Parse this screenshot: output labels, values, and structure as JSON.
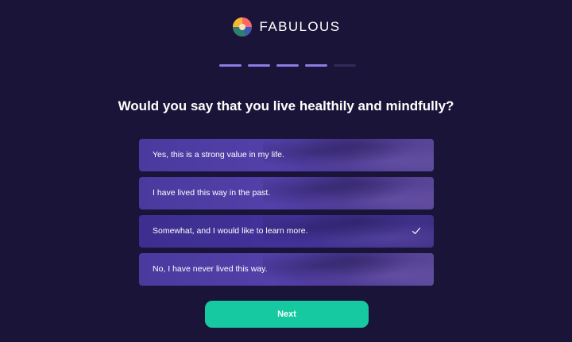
{
  "brand": {
    "name": "FABULOUS",
    "logo_icon": "fabulous-logo-icon"
  },
  "progress": {
    "total_steps": 5,
    "completed_steps": 4,
    "active_color": "#8d7be6",
    "inactive_color": "#312a58"
  },
  "question": {
    "text": "Would you say that you live healthily and mindfully?"
  },
  "options": [
    {
      "label": "Yes, this is a strong value in my life.",
      "selected": false
    },
    {
      "label": "I have lived this way in the past.",
      "selected": false
    },
    {
      "label": "Somewhat, and I would like to learn more.",
      "selected": true
    },
    {
      "label": "No, I have never lived this way.",
      "selected": false
    }
  ],
  "next_button": {
    "label": "Next",
    "color": "#17c9a0"
  },
  "colors": {
    "background": "#1a1438",
    "option_fill": "#4a3a9e"
  }
}
